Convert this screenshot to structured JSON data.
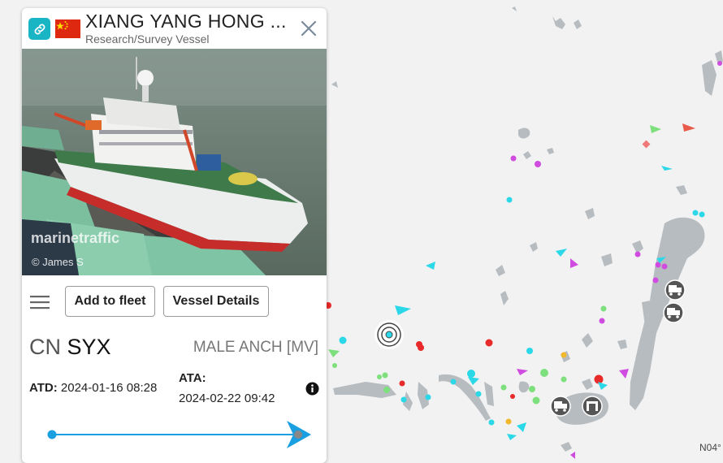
{
  "vessel": {
    "name": "XIANG YANG HONG ...",
    "type": "Research/Survey Vessel",
    "flag_icon": "china-flag-icon"
  },
  "photo": {
    "watermark": "marinetraffic",
    "credit": "© James S"
  },
  "actions": {
    "add_fleet": "Add to fleet",
    "details": "Vessel Details"
  },
  "route": {
    "flag_code": "CN",
    "origin": "SYX",
    "destination": "MALE ANCH [MV]",
    "atd_label": "ATD:",
    "atd_value": "2024-01-16 08:28",
    "ata_label": "ATA:",
    "ata_value": "2024-02-22 09:42",
    "progress": 1.0
  },
  "map": {
    "coordinate": "N04°"
  },
  "colors": {
    "accent": "#1ab5c5",
    "route_line": "#1a9fe0",
    "land": "#b7bcc1",
    "sea": "#f2f2f2"
  }
}
